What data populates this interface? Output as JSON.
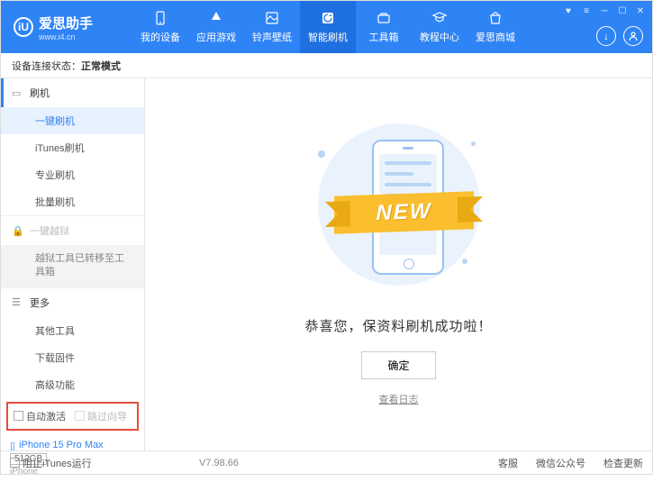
{
  "header": {
    "logo_glyph": "iU",
    "logo_text": "爱思助手",
    "logo_sub": "www.i4.cn",
    "nav": [
      {
        "label": "我的设备"
      },
      {
        "label": "应用游戏"
      },
      {
        "label": "铃声壁纸"
      },
      {
        "label": "智能刷机"
      },
      {
        "label": "工具箱"
      },
      {
        "label": "教程中心"
      },
      {
        "label": "爱思商城"
      }
    ]
  },
  "status": {
    "label": "设备连接状态：",
    "value": "正常模式"
  },
  "sidebar": {
    "flash": {
      "title": "刷机",
      "items": [
        "一键刷机",
        "iTunes刷机",
        "专业刷机",
        "批量刷机"
      ]
    },
    "jailbreak": {
      "title": "一键越狱",
      "note": "越狱工具已转移至工具箱"
    },
    "more": {
      "title": "更多",
      "items": [
        "其他工具",
        "下载固件",
        "高级功能"
      ]
    },
    "options": {
      "auto_activate": "自动激活",
      "skip_setup": "跳过向导"
    },
    "device": {
      "name": "iPhone 15 Pro Max",
      "storage": "512GB",
      "type": "iPhone"
    }
  },
  "main": {
    "ribbon": "NEW",
    "msg": "恭喜您，保资料刷机成功啦！",
    "ok": "确定",
    "log": "查看日志"
  },
  "footer": {
    "block_itunes": "阻止iTunes运行",
    "version": "V7.98.66",
    "items": [
      "客服",
      "微信公众号",
      "检查更新"
    ]
  }
}
